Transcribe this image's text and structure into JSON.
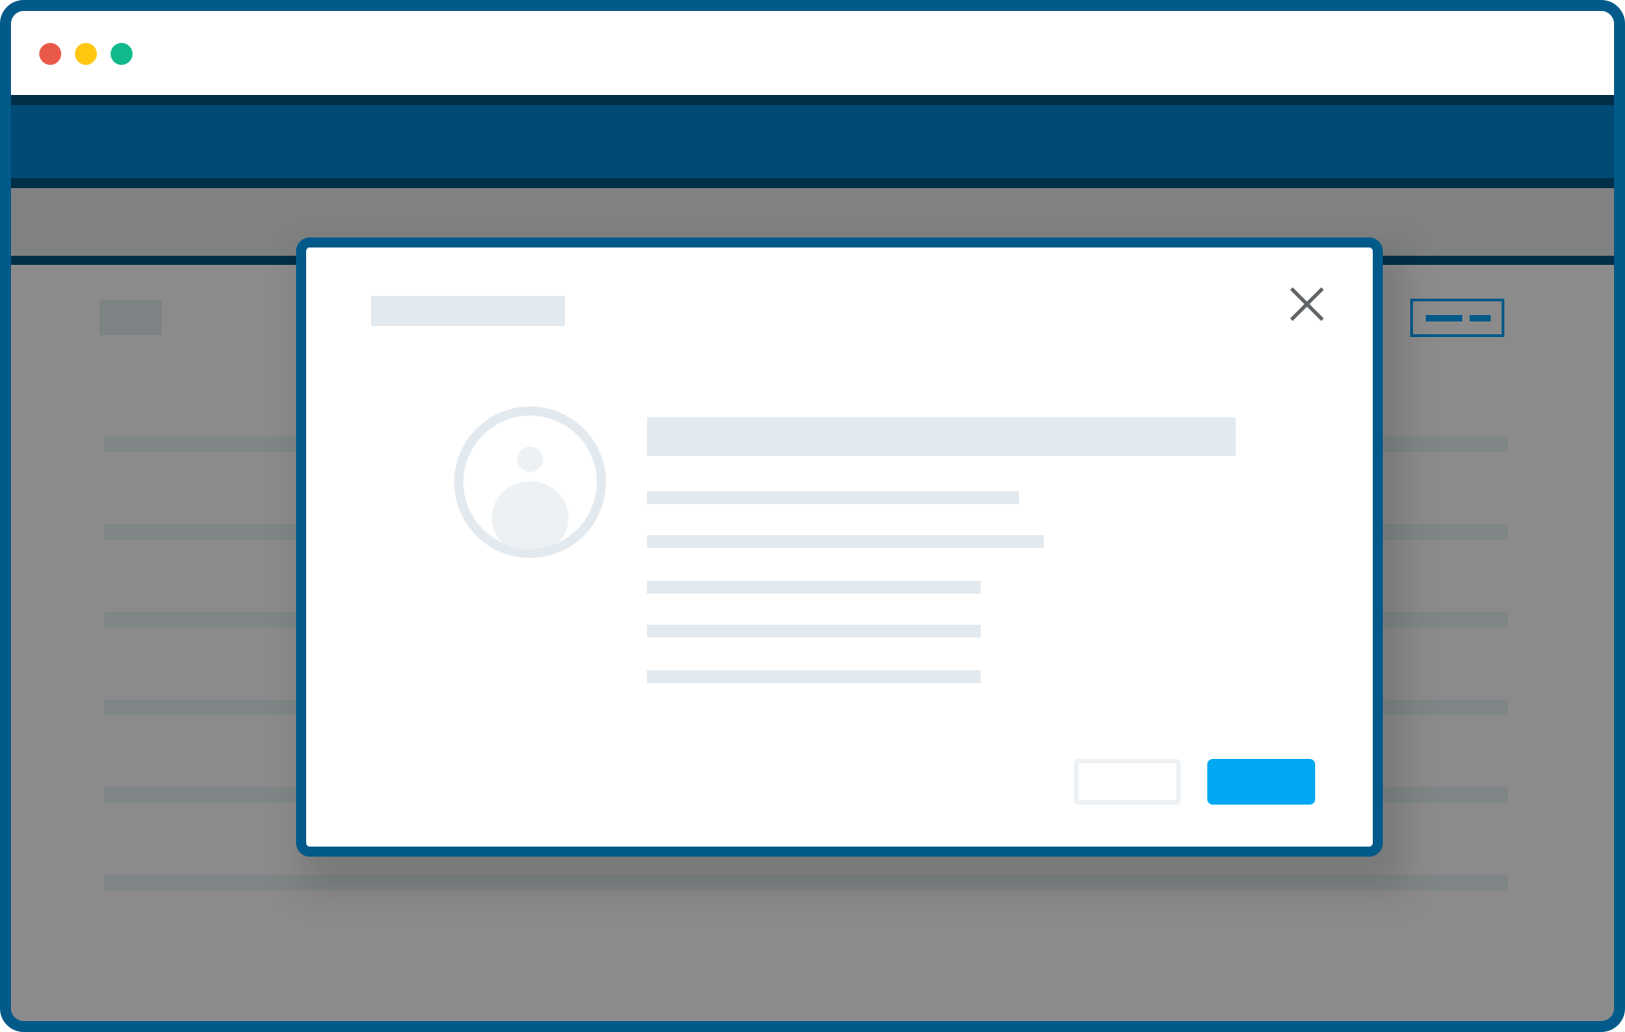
{
  "window": {
    "traffic_lights": [
      "close",
      "minimize",
      "maximize"
    ]
  },
  "colors": {
    "frame": "#025a8a",
    "nav": "#004a73",
    "nav_border": "#022f48",
    "overlay": "#8b8b8b",
    "placeholder": "#e2e9ef",
    "primary": "#01a8f2",
    "close_icon": "#5f6366"
  },
  "modal": {
    "icons": [
      "close-icon",
      "user-avatar-icon"
    ],
    "detail_lines": 5,
    "actions": [
      "secondary",
      "primary"
    ]
  }
}
